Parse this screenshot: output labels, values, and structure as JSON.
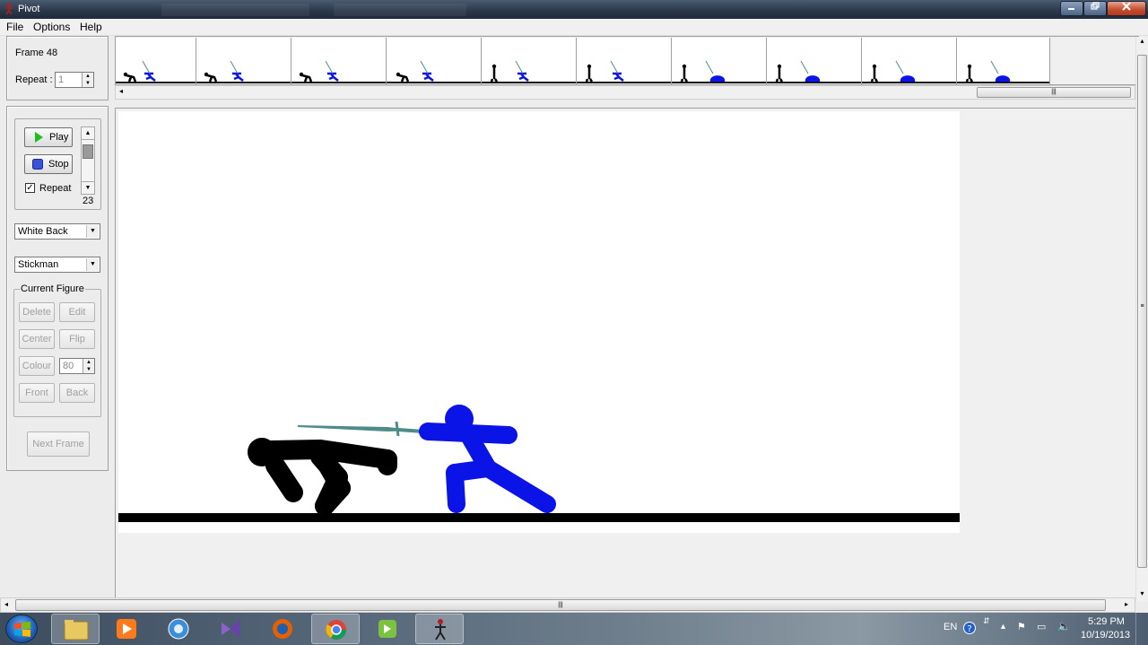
{
  "window": {
    "title": "Pivot"
  },
  "menu": [
    "File",
    "Options",
    "Help"
  ],
  "frame_panel": {
    "frame_label": "Frame 48",
    "repeat_label": "Repeat :",
    "repeat_value": "1"
  },
  "playback": {
    "play_label": "Play",
    "stop_label": "Stop",
    "repeat_check_label": "Repeat",
    "repeat_checked": true,
    "speed_value": "23"
  },
  "background_select": "White Back",
  "figure_type_select": "Stickman",
  "current_figure": {
    "legend": "Current Figure",
    "delete_label": "Delete",
    "edit_label": "Edit",
    "center_label": "Center",
    "flip_label": "Flip",
    "colour_label": "Colour",
    "colour_value": "80",
    "front_label": "Front",
    "back_label": "Back"
  },
  "next_frame_label": "Next Frame",
  "timeline": {
    "frame_count_visible": 10
  },
  "figures": {
    "black_color": "#000000",
    "blue_color": "#0a14e6",
    "sword_color": "#4e8c8c"
  },
  "taskbar": {
    "language": "EN",
    "time": "5:29 PM",
    "date": "10/19/2013"
  }
}
